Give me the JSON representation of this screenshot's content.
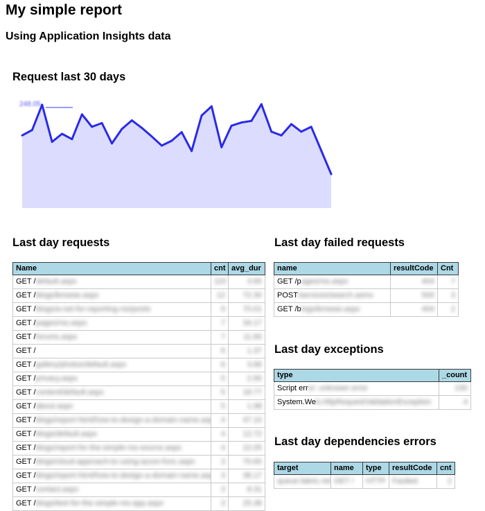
{
  "report": {
    "title": "My simple report",
    "subtitle": "Using Application Insights data"
  },
  "chart_section": {
    "title": "Request last 30 days",
    "legend_text": "248.05"
  },
  "chart_data": {
    "type": "area",
    "title": "Request last 30 days",
    "x": [
      1,
      2,
      3,
      4,
      5,
      6,
      7,
      8,
      9,
      10,
      11,
      12,
      13,
      14,
      15,
      16,
      17,
      18,
      19,
      20,
      21,
      22,
      23,
      24,
      25,
      26,
      27,
      28,
      29,
      30,
      31,
      32
    ],
    "values": [
      175,
      185,
      232,
      163,
      178,
      168,
      214,
      191,
      198,
      160,
      187,
      203,
      189,
      173,
      156,
      165,
      181,
      146,
      212,
      229,
      153,
      193,
      199,
      202,
      233,
      182,
      175,
      196,
      182,
      191,
      147,
      103
    ],
    "ylim": [
      40,
      245
    ],
    "series_color": "#2a2ae8",
    "fill_color": "#dcdcff",
    "grid": false
  },
  "last_day_requests": {
    "title": "Last day requests",
    "columns": [
      "Name",
      "cnt",
      "avg_dur"
    ],
    "rows": [
      {
        "name": "GET /",
        "hidden": "default.aspx",
        "cnt": "115",
        "avg": "3.65"
      },
      {
        "name": "GET /",
        "hidden": "blogs/browse.aspx",
        "cnt": "12",
        "avg": "72.30"
      },
      {
        "name": "GET /",
        "hidden": "blogs/a-net-for-reporting-rss/posts",
        "cnt": "9",
        "avg": "70.01"
      },
      {
        "name": "GET /",
        "hidden": "pages/rss.aspx",
        "cnt": "7",
        "avg": "34.17"
      },
      {
        "name": "GET /",
        "hidden": "forums.aspx",
        "cnt": "7",
        "avg": "11.60"
      },
      {
        "name": "GET /",
        "hidden": "",
        "cnt": "6",
        "avg": "1.37"
      },
      {
        "name": "GET /",
        "hidden": "gallery/photos/default.aspx",
        "cnt": "6",
        "avg": "3.86"
      },
      {
        "name": "GET /",
        "hidden": "privacy.aspx",
        "cnt": "5",
        "avg": "2.90"
      },
      {
        "name": "GET /",
        "hidden": "content/default.aspx",
        "cnt": "5",
        "avg": "18.77"
      },
      {
        "name": "GET /",
        "hidden": "about.aspx",
        "cnt": "5",
        "avg": "1.98"
      },
      {
        "name": "GET /",
        "hidden": "blogs/report-html/how-to-design-a-domain-name.aspx",
        "cnt": "4",
        "avg": "47.10"
      },
      {
        "name": "GET /",
        "hidden": "blogs/default.aspx",
        "cnt": "4",
        "avg": "12.72"
      },
      {
        "name": "GET /",
        "hidden": "blogs/report-for-the-simple-rss-source.aspx",
        "cnt": "4",
        "avg": "22.05"
      },
      {
        "name": "GET /",
        "hidden": "blogs/cloud-approach-to-using-azure-func.aspx",
        "cnt": "3",
        "avg": "70.60"
      },
      {
        "name": "GET /",
        "hidden": "blogs/report-html/how-to-design-a-domain-name.aspx",
        "cnt": "3",
        "avg": "38.17"
      },
      {
        "name": "GET /",
        "hidden": "contact.aspx",
        "cnt": "3",
        "avg": "8.31"
      },
      {
        "name": "GET /",
        "hidden": "blogs/test-for-the-simple-rss-app.aspx",
        "cnt": "3",
        "avg": "25.38"
      }
    ]
  },
  "last_day_failed_requests": {
    "title": "Last day failed requests",
    "columns": [
      "name",
      "resultCode",
      "Cnt"
    ],
    "rows": [
      {
        "name": "GET /p",
        "hidden": "ages/rss.aspx",
        "code": "404",
        "cnt": "7"
      },
      {
        "name": "POST",
        "hidden": " /services/search.asmx",
        "code": "500",
        "cnt": "3"
      },
      {
        "name": "GET /b",
        "hidden": "logs/browse.aspx",
        "code": "404",
        "cnt": "2"
      }
    ]
  },
  "last_day_exceptions": {
    "title": "Last day exceptions",
    "columns": [
      "type",
      "_count"
    ],
    "rows": [
      {
        "type": "Script err",
        "hidden": "or: unknown error",
        "count": "230"
      },
      {
        "type": "System.We",
        "hidden": "b.HttpRequestValidationException",
        "count": "4"
      }
    ]
  },
  "last_day_dependencies_errors": {
    "title": "Last day dependencies errors",
    "columns": [
      "target",
      "name",
      "type",
      "resultCode",
      "cnt"
    ],
    "rows": [
      {
        "target": "queue.fabric.net",
        "name": "GET /",
        "type": "HTTP",
        "code": "Faulted",
        "cnt": "2"
      }
    ]
  }
}
